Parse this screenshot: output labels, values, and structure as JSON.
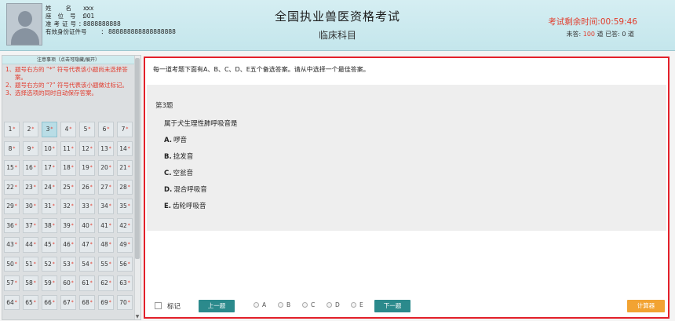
{
  "header": {
    "info": [
      {
        "label": "姓名",
        "value": "xxx"
      },
      {
        "label": "座位号",
        "value": "001"
      },
      {
        "label": "准考证号",
        "value": "8888888888"
      },
      {
        "label": "有效身份证件号",
        "value": "888888888888888888"
      }
    ],
    "title": "全国执业兽医资格考试",
    "subject": "临床科目",
    "timer_label": "考试剩余时间:",
    "timer_value": "00:59:46",
    "unanswered_label": "未答:",
    "unanswered_count": "100",
    "unanswered_unit": "道",
    "answered_label": "已答:",
    "answered_count": "0",
    "answered_unit": "道"
  },
  "notice": {
    "heading": "注意事项（点击可隐藏/展开）",
    "items": [
      {
        "num": "1、",
        "text": "题号右方的 “*” 符号代表该小题尚未选择答案。"
      },
      {
        "num": "2、",
        "text": "题号右方的 “?” 符号代表该小题做过标记。"
      },
      {
        "num": "3、",
        "text": "选择选项的同时自动保存答案。"
      }
    ]
  },
  "question_grid": {
    "current": "3",
    "marker": "*",
    "numbers": [
      "1",
      "2",
      "3",
      "4",
      "5",
      "6",
      "7",
      "8",
      "9",
      "10",
      "11",
      "12",
      "13",
      "14",
      "15",
      "16",
      "17",
      "18",
      "19",
      "20",
      "21",
      "22",
      "23",
      "24",
      "25",
      "26",
      "27",
      "28",
      "29",
      "30",
      "31",
      "32",
      "33",
      "34",
      "35",
      "36",
      "37",
      "38",
      "39",
      "40",
      "41",
      "42",
      "43",
      "44",
      "45",
      "46",
      "47",
      "48",
      "49",
      "50",
      "51",
      "52",
      "53",
      "54",
      "55",
      "56",
      "57",
      "58",
      "59",
      "60",
      "61",
      "62",
      "63",
      "64",
      "65",
      "66",
      "67",
      "68",
      "69",
      "70"
    ]
  },
  "question": {
    "instruction": "每一道考题下面有A、B、C、D、E五个备选答案。请从中选择一个最佳答案。",
    "number_label": "第3题",
    "stem": "属于犬生理性肺呼吸音是",
    "options": [
      {
        "letter": "A.",
        "text": "啰音"
      },
      {
        "letter": "B.",
        "text": "捻发音"
      },
      {
        "letter": "C.",
        "text": "空瓮音"
      },
      {
        "letter": "D.",
        "text": "混合呼吸音"
      },
      {
        "letter": "E.",
        "text": "齿轮呼吸音"
      }
    ]
  },
  "toolbar": {
    "mark_label": "标记",
    "prev_label": "上一题",
    "next_label": "下一题",
    "submit_label": "计算器",
    "answer_choices": [
      "A",
      "B",
      "C",
      "D",
      "E"
    ]
  },
  "colors": {
    "accent_red": "#e3202a",
    "teal_button": "#2b8a8c",
    "orange_button": "#f2a332",
    "header_bg": "#c4e6ec"
  }
}
